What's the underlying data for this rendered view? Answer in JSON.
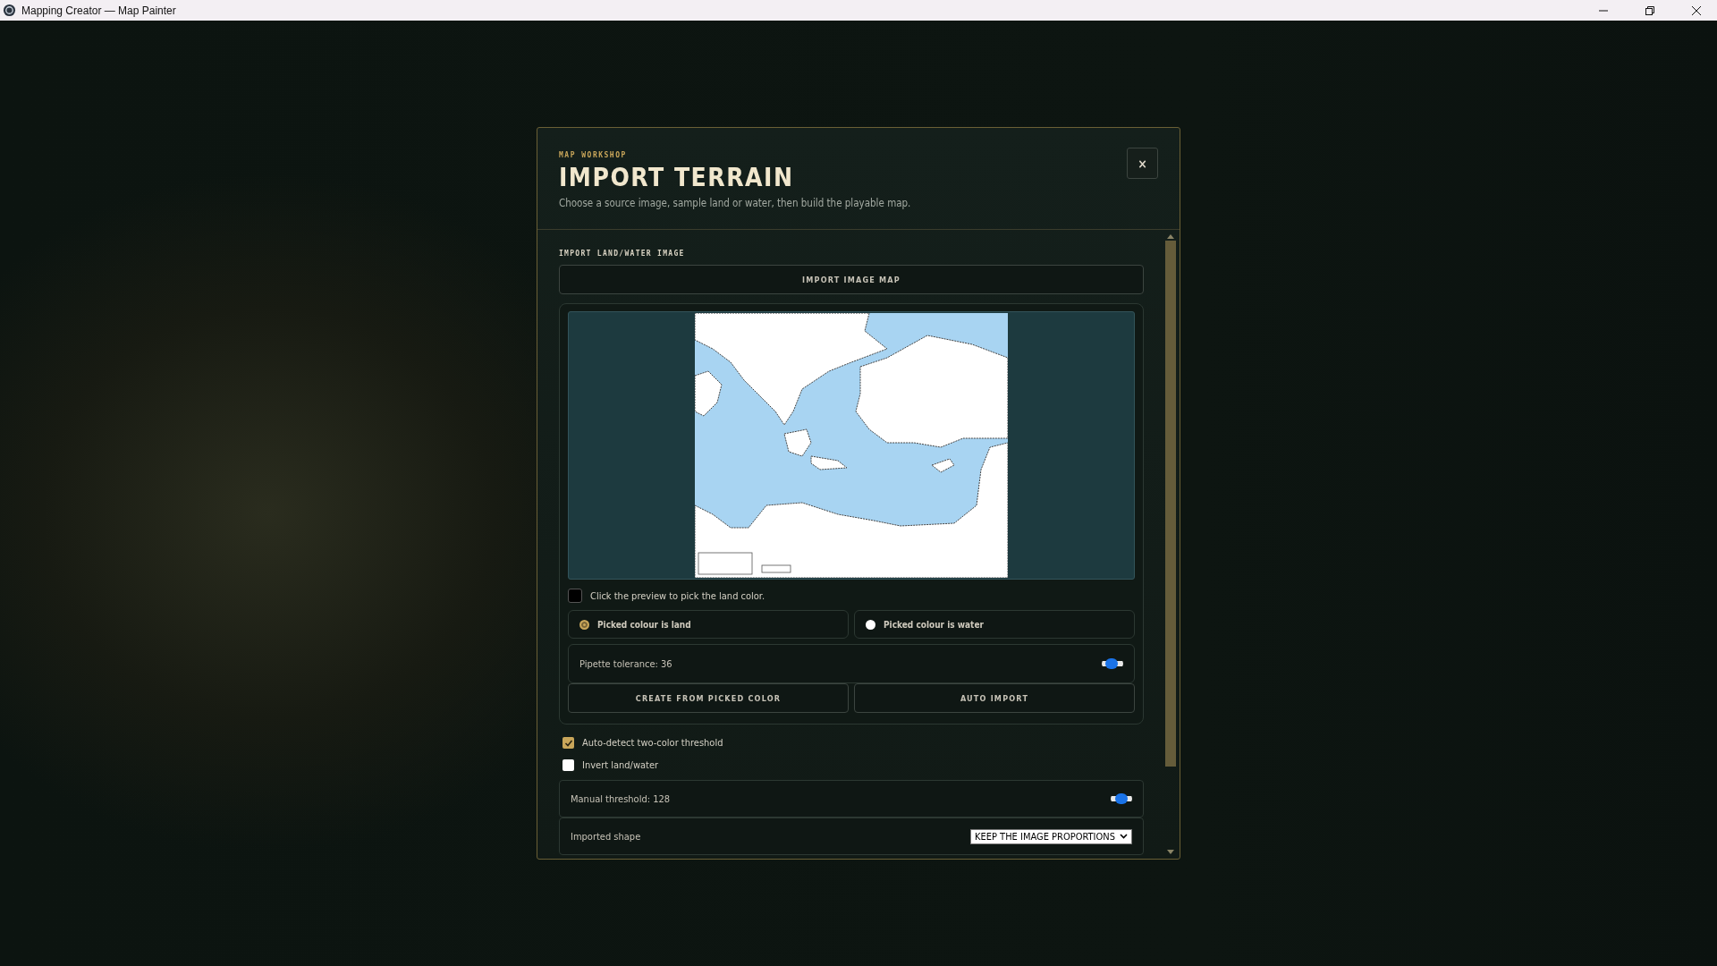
{
  "window": {
    "title": "Mapping Creator — Map Painter"
  },
  "dialog": {
    "eyebrow": "MAP WORKSHOP",
    "title": "IMPORT TERRAIN",
    "subtitle": "Choose a source image, sample land or water, then build the playable map.",
    "close": "×",
    "section_label": "IMPORT LAND/WATER IMAGE",
    "import_button": "IMPORT IMAGE MAP",
    "pick_hint": {
      "label": "Click the preview to pick the land color.",
      "checked": false
    },
    "picked_options": [
      {
        "label": "Picked colour is land",
        "selected": true
      },
      {
        "label": "Picked colour is water",
        "selected": false
      }
    ],
    "pipette": {
      "label": "Pipette tolerance: 36",
      "level": 0.36
    },
    "actions": [
      "CREATE FROM PICKED COLOR",
      "AUTO IMPORT"
    ],
    "options": [
      {
        "label": "Auto-detect two-color threshold",
        "checked": true
      },
      {
        "label": "Invert land/water",
        "checked": false
      }
    ],
    "threshold": {
      "label": "Manual threshold: 128",
      "level": 0.5
    },
    "shape": {
      "label": "Imported shape",
      "value": "KEEP THE IMAGE PROPORTIONS"
    }
  }
}
